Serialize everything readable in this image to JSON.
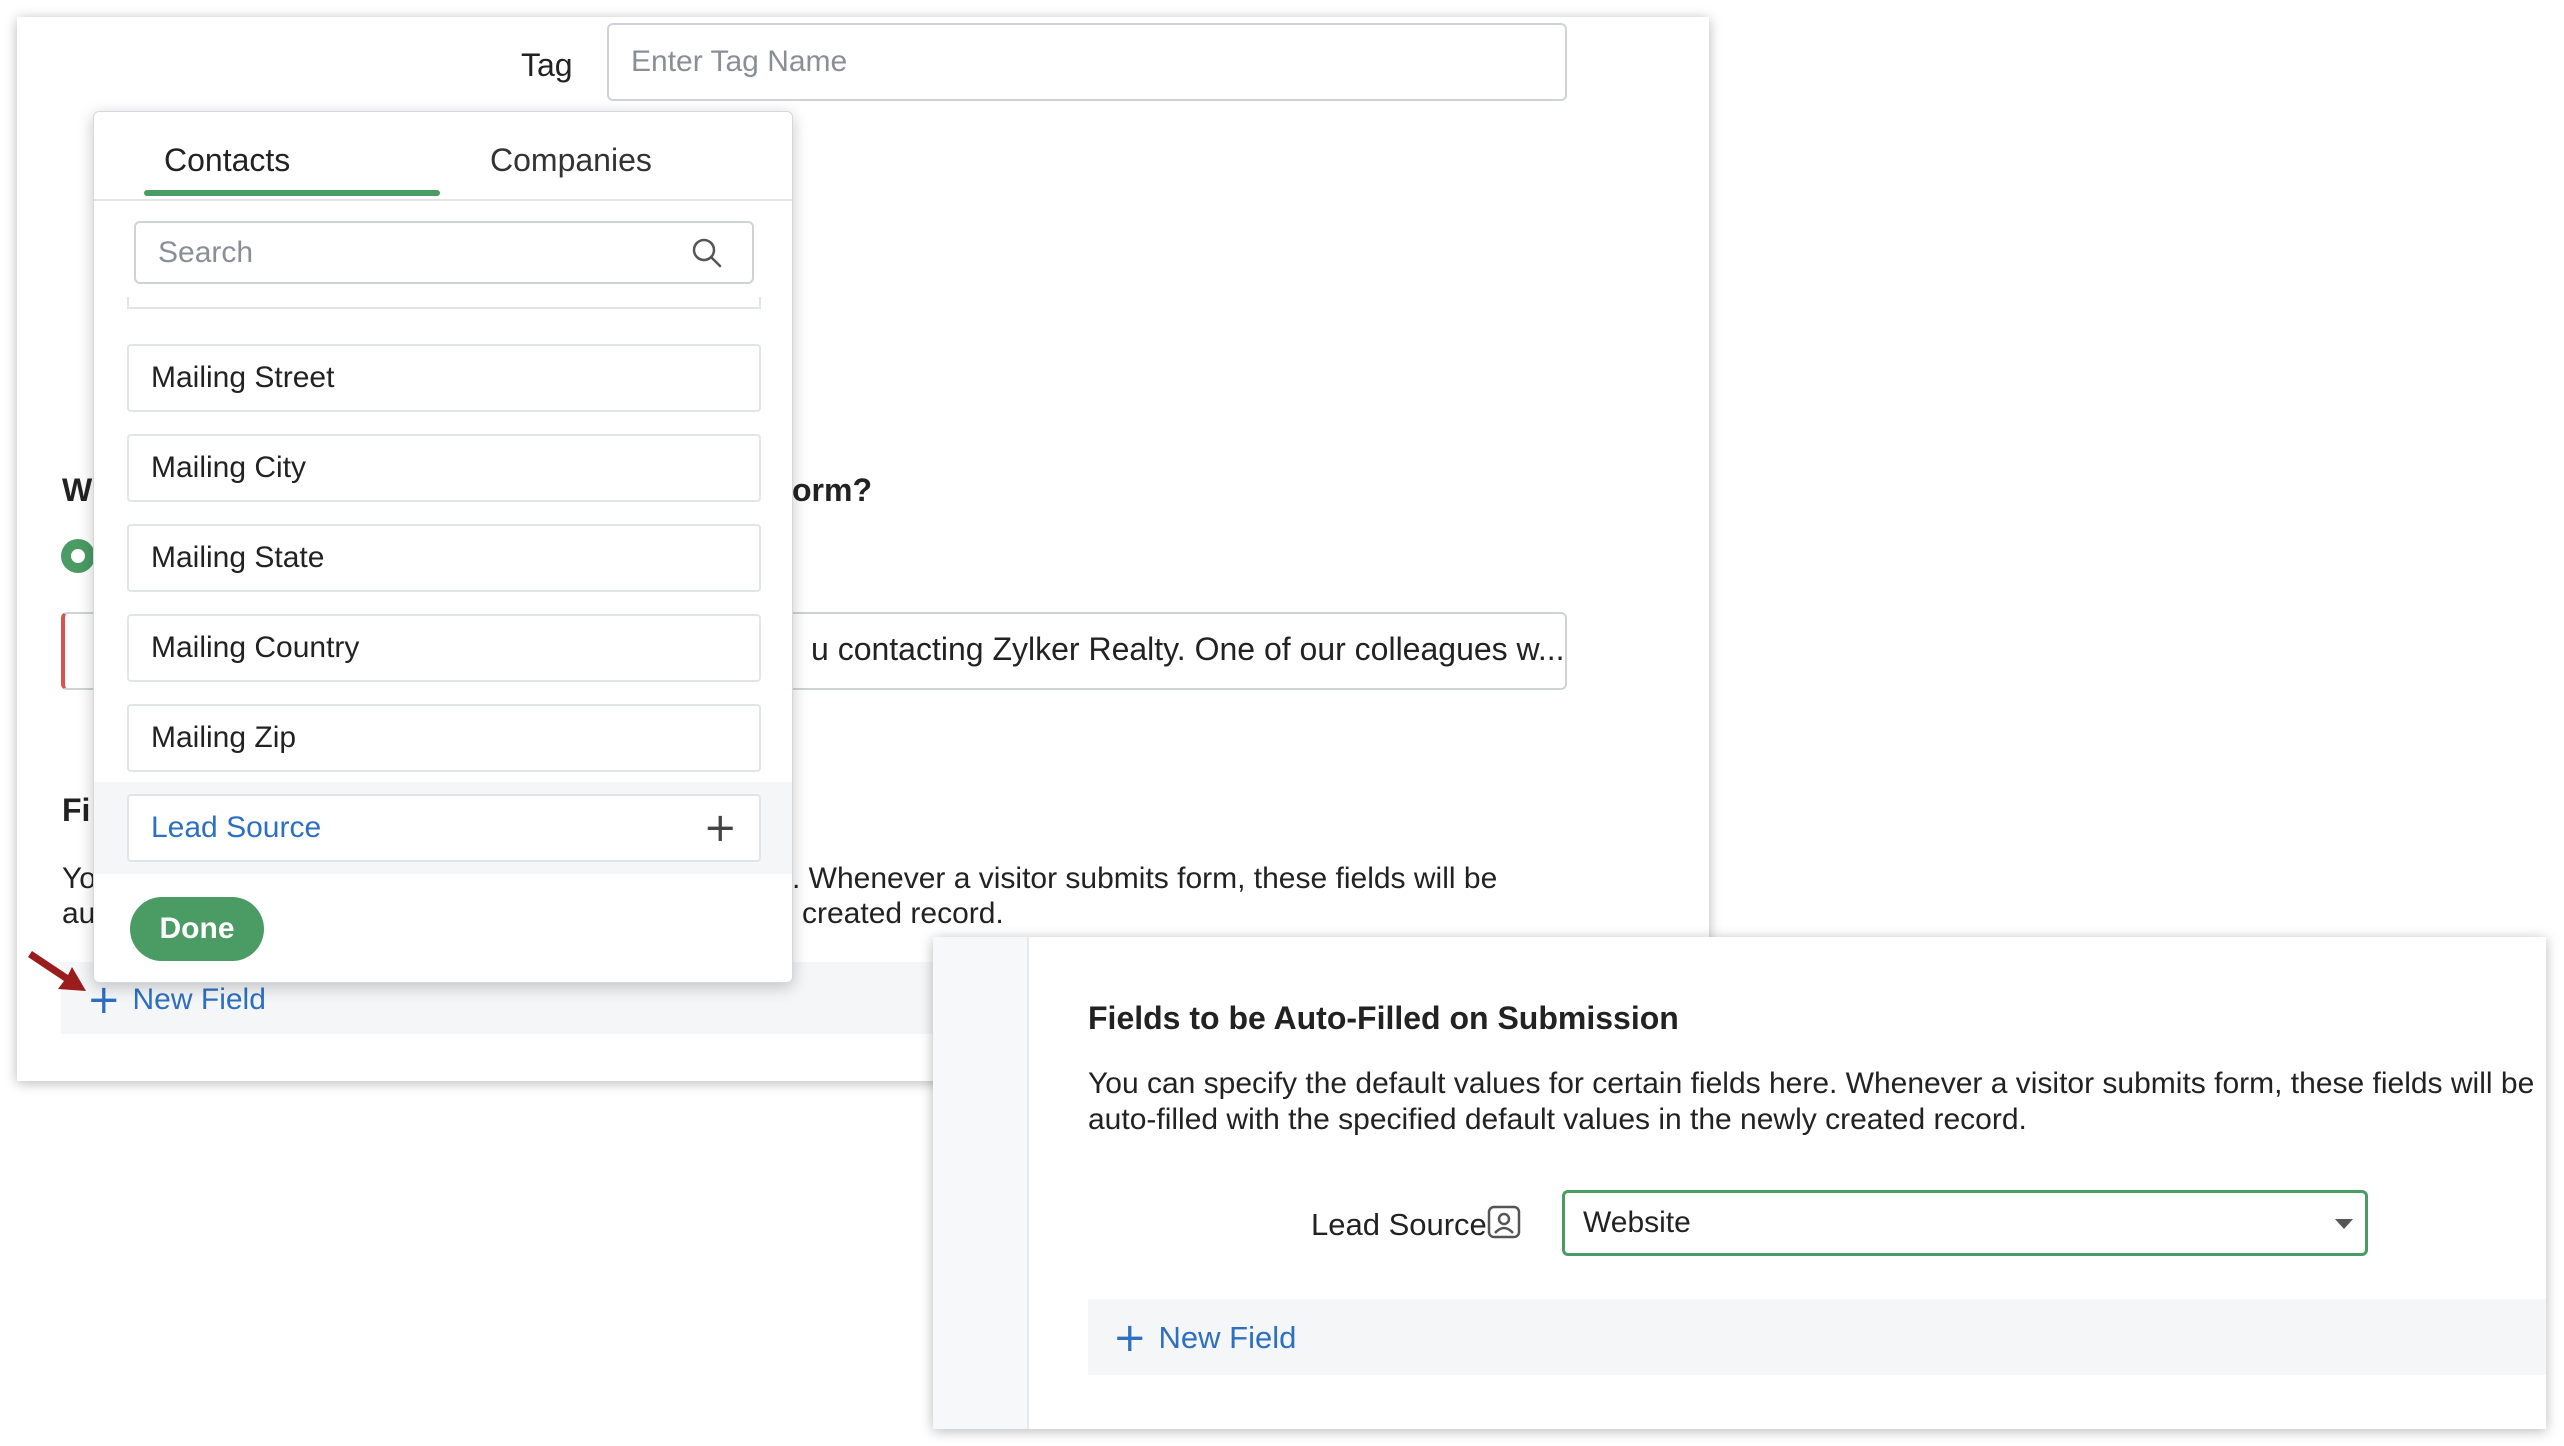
{
  "back": {
    "tag_label": "Tag",
    "tag_placeholder": "Enter Tag Name",
    "question_left": "W",
    "question_right": "orm?",
    "message_text": "u contacting Zylker Realty. One of our colleagues w...",
    "fields_heading_fragment": "Fi",
    "desc_left_line1": "Yo",
    "desc_left_line2": "au",
    "desc_right_line1": ". Whenever a visitor submits form, these fields will be",
    "desc_right_line2": "created record.",
    "new_field_label": "New Field"
  },
  "popup": {
    "tabs": [
      {
        "label": "Contacts",
        "active": true
      },
      {
        "label": "Companies",
        "active": false
      }
    ],
    "search_placeholder": "Search",
    "fields": [
      "Mailing Street",
      "Mailing City",
      "Mailing State",
      "Mailing Country",
      "Mailing Zip"
    ],
    "highlighted_field": "Lead Source",
    "done_label": "Done"
  },
  "front": {
    "heading": "Fields to be Auto-Filled on Submission",
    "description_line1": "You can specify the default values for certain fields here. Whenever a visitor submits form, these fields will be",
    "description_line2": "auto-filled with the specified default values in the newly created record.",
    "lead_source_label": "Lead Source",
    "lead_source_value": "Website",
    "new_field_label": "New Field"
  },
  "colors": {
    "accent_green": "#4a9b64",
    "link_blue": "#2d6fc0",
    "arrow_red": "#9b1c1c"
  }
}
